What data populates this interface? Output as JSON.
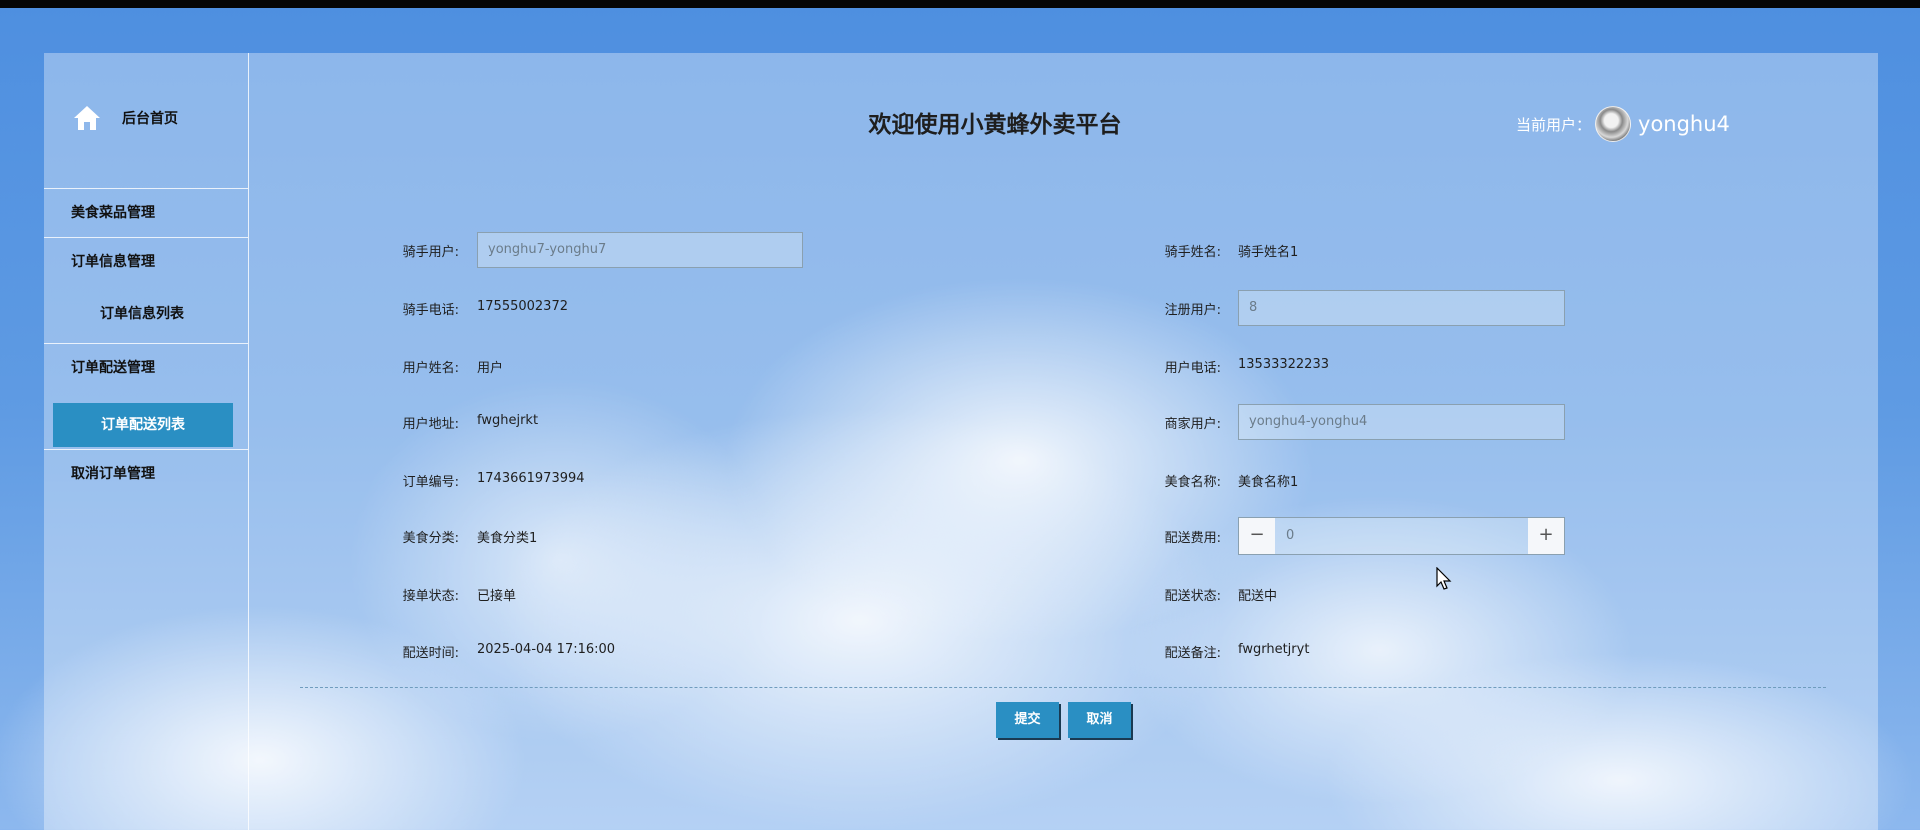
{
  "app": {
    "title": "欢迎使用小黄蜂外卖平台",
    "current_user_label": "当前用户：",
    "current_user": "yonghu4"
  },
  "sidebar": {
    "home": "后台首页",
    "items": [
      {
        "label": "美食菜品管理"
      },
      {
        "label": "订单信息管理"
      },
      {
        "label": "订单信息列表"
      },
      {
        "label": "订单配送管理"
      },
      {
        "label": "订单配送列表"
      },
      {
        "label": "取消订单管理"
      }
    ]
  },
  "form": {
    "rider_user": {
      "label": "骑手用户:",
      "value": "yonghu7-yonghu7"
    },
    "rider_name": {
      "label": "骑手姓名:",
      "value": "骑手姓名1"
    },
    "rider_phone": {
      "label": "骑手电话:",
      "value": "17555002372"
    },
    "registered_user": {
      "label": "注册用户:",
      "value": "8"
    },
    "user_name": {
      "label": "用户姓名:",
      "value": "用户"
    },
    "user_phone": {
      "label": "用户电话:",
      "value": "13533322233"
    },
    "user_address": {
      "label": "用户地址:",
      "value": "fwghejrkt"
    },
    "merchant_user": {
      "label": "商家用户:",
      "value": "yonghu4-yonghu4"
    },
    "order_number": {
      "label": "订单编号:",
      "value": "1743661973994"
    },
    "food_name": {
      "label": "美食名称:",
      "value": "美食名称1"
    },
    "food_category": {
      "label": "美食分类:",
      "value": "美食分类1"
    },
    "delivery_fee": {
      "label": "配送费用:",
      "value": "0",
      "minus": "−",
      "plus": "+"
    },
    "accept_status": {
      "label": "接单状态:",
      "value": "已接单"
    },
    "delivery_status": {
      "label": "配送状态:",
      "value": "配送中"
    },
    "delivery_time": {
      "label": "配送时间:",
      "value": "2025-04-04 17:16:00"
    },
    "delivery_note": {
      "label": "配送备注:",
      "value": "fwgrhetjryt"
    }
  },
  "buttons": {
    "submit": "提交",
    "cancel": "取消"
  },
  "colors": {
    "accent": "#2a8fc3",
    "background": "#5f9be3"
  }
}
